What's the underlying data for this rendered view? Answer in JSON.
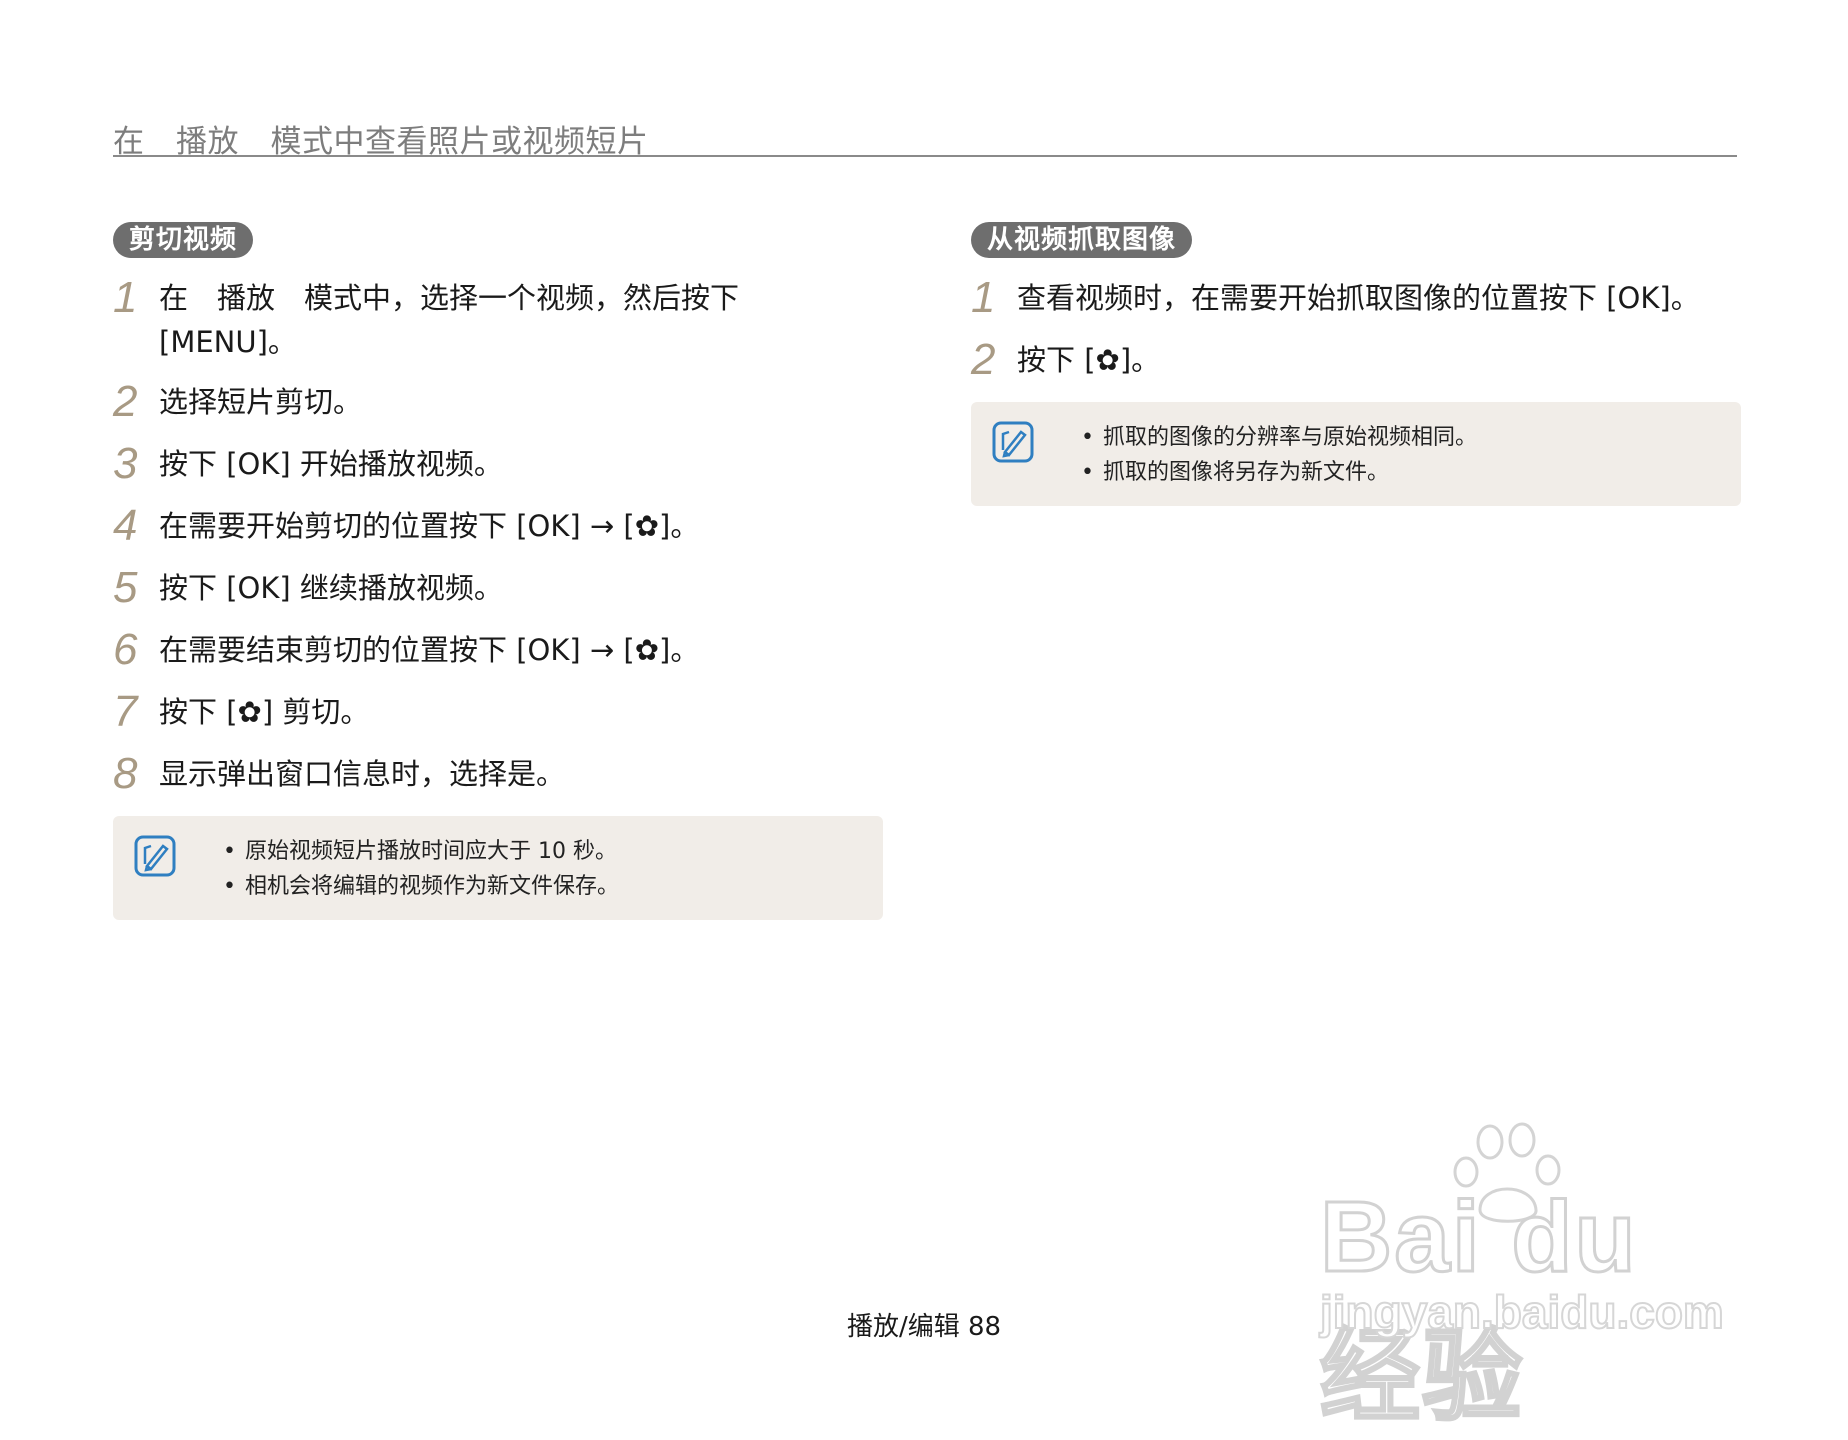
{
  "header": {
    "title": "在　播放　模式中查看照片或视频短片"
  },
  "left": {
    "pill": "剪切视频",
    "steps": [
      {
        "num": "1",
        "text": "在　播放　模式中，选择一个视频，然后按下\n[MENU]。"
      },
      {
        "num": "2",
        "text": "选择短片剪切。"
      },
      {
        "num": "3",
        "text": "按下 [OK] 开始播放视频。"
      },
      {
        "num": "4",
        "text": "在需要开始剪切的位置按下 [OK] → [✿]。"
      },
      {
        "num": "5",
        "text": "按下 [OK] 继续播放视频。"
      },
      {
        "num": "6",
        "text": "在需要结束剪切的位置按下 [OK] → [✿]。"
      },
      {
        "num": "7",
        "text": "按下 [✿] 剪切。"
      },
      {
        "num": "8",
        "text": "显示弹出窗口信息时，选择是。"
      }
    ],
    "notes": [
      "原始视频短片播放时间应大于 10 秒。",
      "相机会将编辑的视频作为新文件保存。"
    ]
  },
  "right": {
    "pill": "从视频抓取图像",
    "steps": [
      {
        "num": "1",
        "text": "查看视频时，在需要开始抓取图像的位置按下 [OK]。"
      },
      {
        "num": "2",
        "text": "按下 [✿]。"
      }
    ],
    "notes": [
      "抓取的图像的分辨率与原始视频相同。",
      "抓取的图像将另存为新文件。"
    ]
  },
  "footer": {
    "page": "播放/编辑  88"
  },
  "watermark": {
    "brand": "Bai du 经验",
    "url": "jingyan.baidu.com"
  },
  "icons": {
    "note": "note-pencil-icon"
  },
  "colors": {
    "pill_bg": "#6e6e6e",
    "step_num": "#a89a84",
    "note_bg": "#f1ede8",
    "note_icon": "#2f7fc1"
  }
}
